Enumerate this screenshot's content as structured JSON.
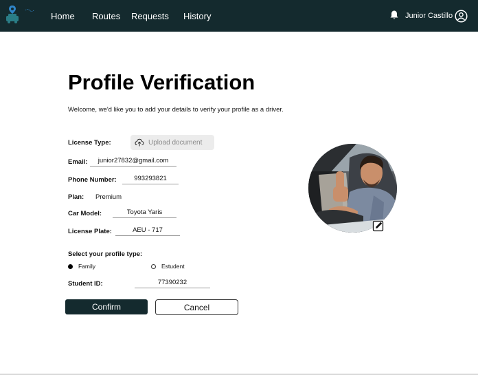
{
  "nav": {
    "items": [
      {
        "label": "Home"
      },
      {
        "label": "Routes"
      },
      {
        "label": "Requests"
      },
      {
        "label": "History"
      }
    ],
    "user_name": "Junior Castillo",
    "icons": {
      "logo": "car-pin-logo-icon",
      "bell": "bell-icon",
      "user": "user-circle-icon"
    }
  },
  "page": {
    "title": "Profile Verification",
    "subtitle": "Welcome, we'd like you to add your details to verify your profile as a driver."
  },
  "form": {
    "license_type_label": "License Type:",
    "upload_label": "Upload document",
    "email_label": "Email:",
    "email_value": "junior27832@gmail.com",
    "phone_label": "Phone Number:",
    "phone_value": "993293821",
    "plan_label": "Plan:",
    "plan_value": "Premium",
    "car_model_label": "Car Model:",
    "car_model_value": "Toyota Yaris",
    "plate_label": "License Plate:",
    "plate_value": "AEU - 717",
    "profile_type_label": "Select your profile type:",
    "profile_options": [
      {
        "label": "Family",
        "selected": true
      },
      {
        "label": "Estudent",
        "selected": false
      }
    ],
    "student_id_label": "Student ID:",
    "student_id_value": "77390232"
  },
  "actions": {
    "confirm_label": "Confirm",
    "cancel_label": "Cancel"
  },
  "colors": {
    "brand_dark": "#142a2e",
    "accent_teal": "#2a7d86",
    "pin_blue": "#2f86c9"
  }
}
